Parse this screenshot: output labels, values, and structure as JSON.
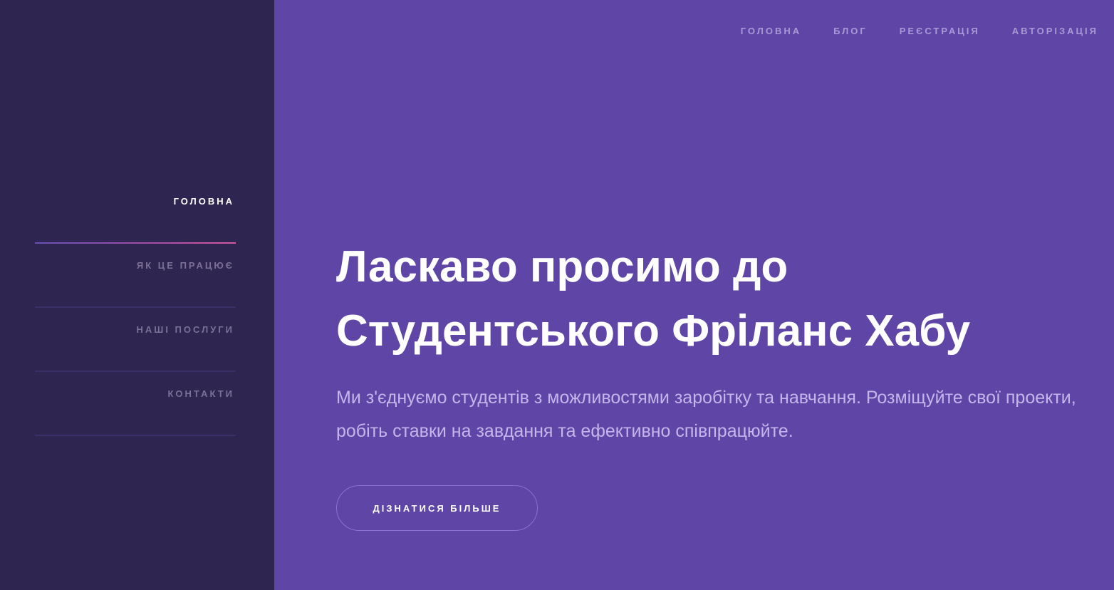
{
  "sidebar": {
    "items": [
      {
        "label": "ГОЛОВНА",
        "active": true
      },
      {
        "label": "ЯК ЦЕ ПРАЦЮЄ",
        "active": false
      },
      {
        "label": "НАШІ ПОСЛУГИ",
        "active": false
      },
      {
        "label": "КОНТАКТИ",
        "active": false
      }
    ]
  },
  "header": {
    "nav": [
      {
        "label": "ГОЛОВНА"
      },
      {
        "label": "БЛОГ"
      },
      {
        "label": "РЕЄСТРАЦІЯ"
      },
      {
        "label": "АВТОРІЗАЦІЯ"
      }
    ]
  },
  "hero": {
    "title_line1": "Ласкаво просимо до",
    "title_line2": "Студентського Фріланс Хабу",
    "description": "Ми з'єднуємо студентів з можливостями заробітку та навчання. Розміщуйте свої проекти, робіть ставки на завдання та ефективно співпрацюйте.",
    "button_label": "ДІЗНАТИСЯ БІЛЬШЕ"
  },
  "colors": {
    "sidebar_bg": "#2e2550",
    "main_bg": "#5e45a6",
    "accent_gradient_start": "#6a4fb8",
    "accent_gradient_end": "#d35ba0"
  }
}
